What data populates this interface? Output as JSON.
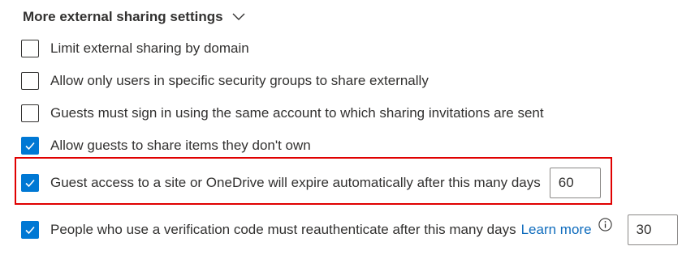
{
  "section": {
    "title": "More external sharing settings",
    "chevron_icon": "chevron-down-icon"
  },
  "settings": [
    {
      "label": "Limit external sharing by domain",
      "checked": false
    },
    {
      "label": "Allow only users in specific security groups to share externally",
      "checked": false
    },
    {
      "label": "Guests must sign in using the same account to which sharing invitations are sent",
      "checked": false
    },
    {
      "label": "Allow guests to share items they don't own",
      "checked": true
    },
    {
      "label": "Guest access to a site or OneDrive will expire automatically after this many days",
      "checked": true,
      "value": "60",
      "highlighted": true
    },
    {
      "label": "People who use a verification code must reauthenticate after this many days",
      "checked": true,
      "value": "30",
      "link": "Learn more",
      "info_icon": "info-icon"
    }
  ],
  "colors": {
    "accent": "#0078d4",
    "link": "#0f6cbd",
    "highlight": "#e00000",
    "text": "#323130"
  }
}
